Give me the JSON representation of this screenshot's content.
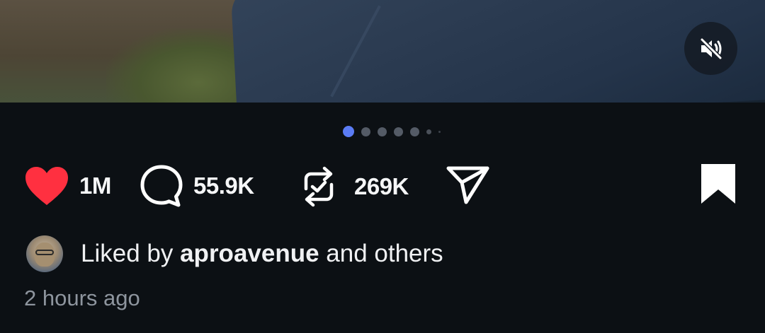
{
  "media": {
    "mute_icon": "speaker-muted-icon"
  },
  "carousel": {
    "total_dots": 7,
    "active_index": 0,
    "active_color": "#5b7cf5"
  },
  "actions": {
    "like": {
      "icon": "heart-filled-icon",
      "count": "1M",
      "color": "#ff3040"
    },
    "comment": {
      "icon": "comment-bubble-icon",
      "count": "55.9K"
    },
    "repost": {
      "icon": "repost-icon",
      "count": "269K"
    },
    "share": {
      "icon": "paper-plane-icon"
    },
    "save": {
      "icon": "bookmark-filled-icon"
    }
  },
  "liked_by": {
    "prefix": "Liked by ",
    "username": "aproavenue",
    "suffix": " and others"
  },
  "timestamp": "2 hours ago"
}
